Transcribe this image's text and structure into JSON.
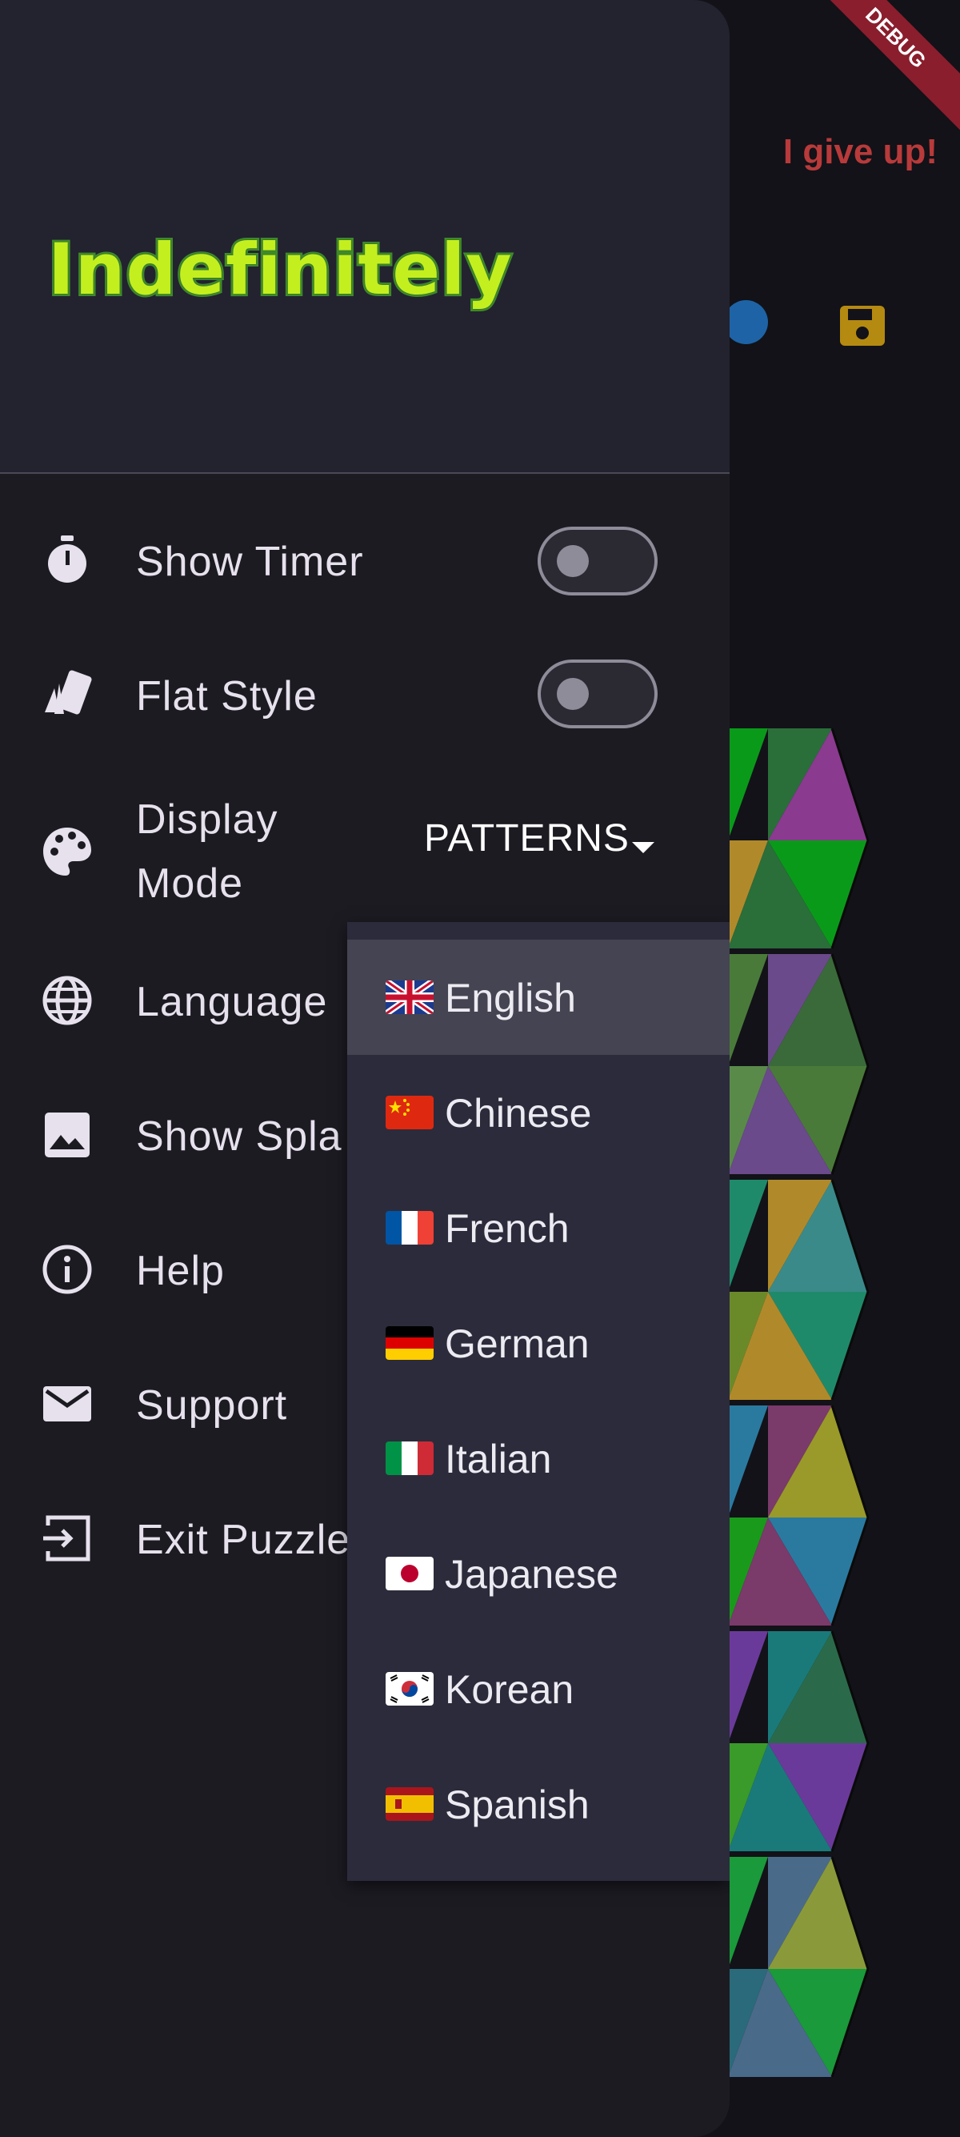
{
  "background": {
    "give_up_label": "I give up!",
    "debug_banner": "DEBUG"
  },
  "drawer": {
    "logo": "Indefinitely",
    "items": [
      {
        "label": "Show Timer",
        "icon": "timer-icon",
        "toggle": false
      },
      {
        "label": "Flat Style",
        "icon": "cards-icon",
        "toggle": false
      },
      {
        "label": "Display\nMode",
        "icon": "palette-icon"
      },
      {
        "label": "Language",
        "icon": "globe-icon"
      },
      {
        "label": "Show Spla",
        "icon": "image-icon"
      },
      {
        "label": "Help",
        "icon": "info-icon"
      },
      {
        "label": "Support",
        "icon": "mail-icon"
      },
      {
        "label": "Exit Puzzle",
        "icon": "exit-icon"
      }
    ],
    "display_mode_value": "PATTERNS"
  },
  "language_menu": {
    "selected": "English",
    "options": [
      {
        "label": "English",
        "flag": "uk-flag"
      },
      {
        "label": "Chinese",
        "flag": "china-flag"
      },
      {
        "label": "French",
        "flag": "france-flag"
      },
      {
        "label": "German",
        "flag": "germany-flag"
      },
      {
        "label": "Italian",
        "flag": "italy-flag"
      },
      {
        "label": "Japanese",
        "flag": "japan-flag"
      },
      {
        "label": "Korean",
        "flag": "korea-flag"
      },
      {
        "label": "Spanish",
        "flag": "spain-flag"
      }
    ]
  },
  "colors": {
    "drawer_bg": "#1c1b22",
    "header_bg": "#23222f",
    "menu_bg": "#2c2b3b",
    "menu_selected": "#454452",
    "give_up": "#b83a3a",
    "logo_fill": "#c4ef1f",
    "logo_stroke": "#3f8a2c"
  }
}
